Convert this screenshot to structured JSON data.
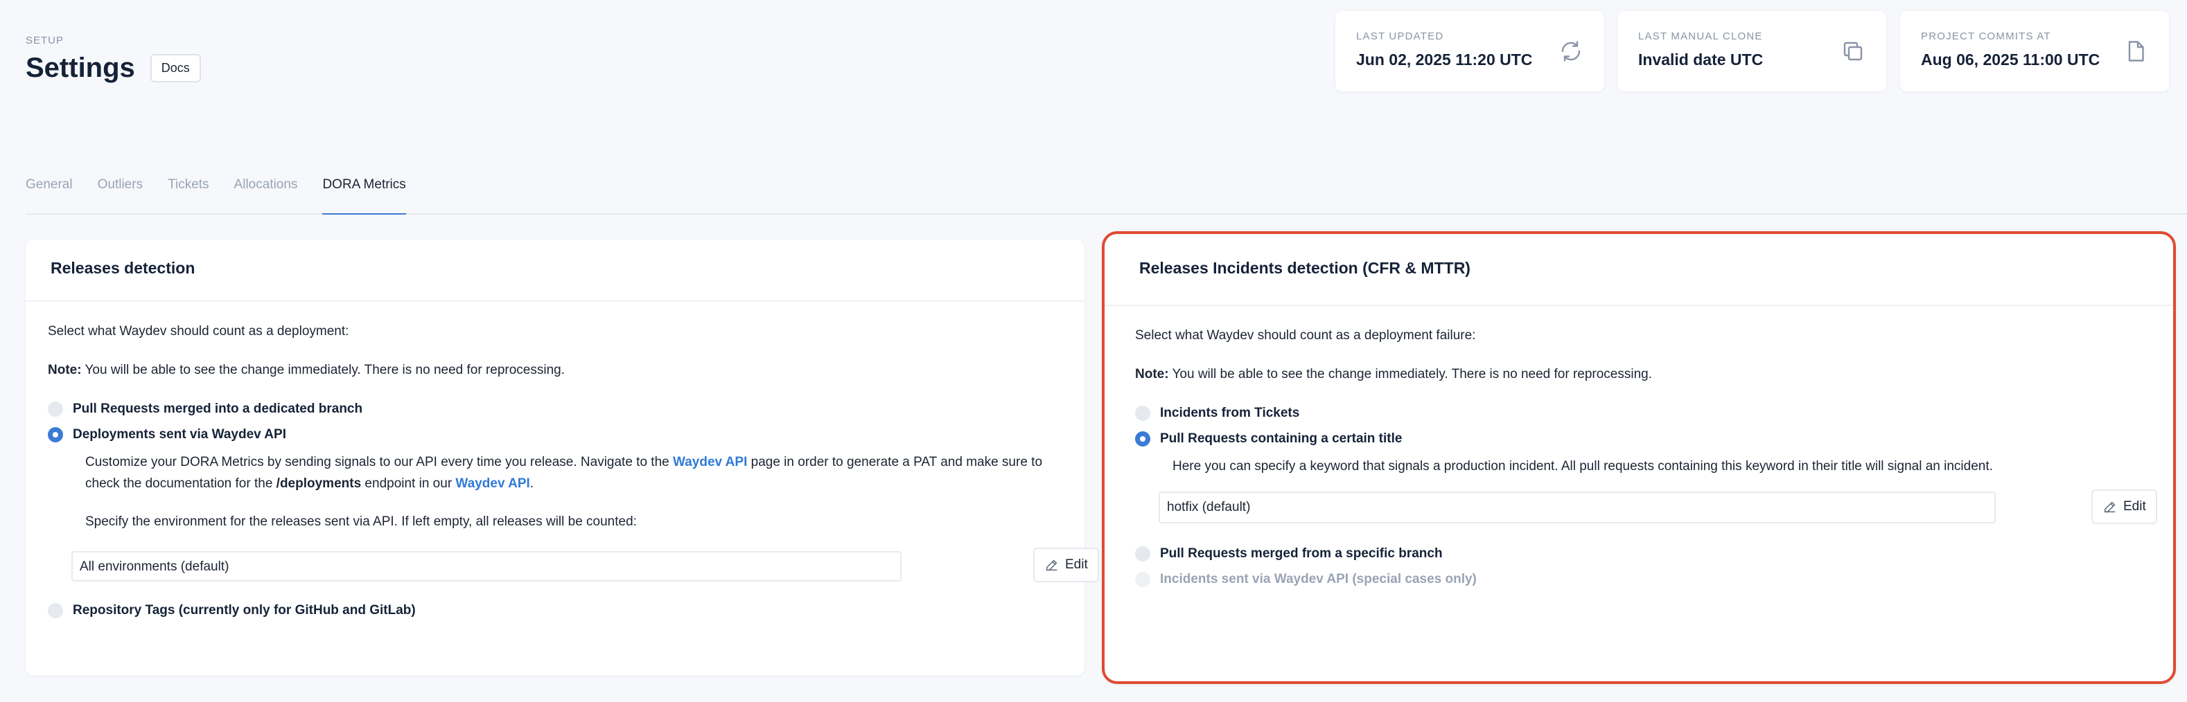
{
  "header": {
    "setup_label": "SETUP",
    "title": "Settings",
    "docs_label": "Docs"
  },
  "stats": [
    {
      "label": "LAST UPDATED",
      "value": "Jun 02, 2025 11:20 UTC",
      "icon": "refresh-icon"
    },
    {
      "label": "LAST MANUAL CLONE",
      "value": "Invalid date UTC",
      "icon": "copy-icon"
    },
    {
      "label": "PROJECT COMMITS AT",
      "value": "Aug 06, 2025 11:00 UTC",
      "icon": "file-icon"
    }
  ],
  "tabs": [
    {
      "label": "General"
    },
    {
      "label": "Outliers"
    },
    {
      "label": "Tickets"
    },
    {
      "label": "Allocations"
    },
    {
      "label": "DORA Metrics",
      "active": true
    }
  ],
  "releases": {
    "title": "Releases detection",
    "prompt": "Select what Waydev should count as a deployment:",
    "note_label": "Note:",
    "note_text": " You will be able to see the change immediately. There is no need for reprocessing.",
    "option_pr": "Pull Requests merged into a dedicated branch",
    "option_api": "Deployments sent via Waydev API",
    "desc_1": "Customize your DORA Metrics by sending signals to our API every time you release. Navigate to the ",
    "desc_link_1": "Waydev API",
    "desc_2": " page in order to generate a PAT and make sure to check the documentation for the ",
    "desc_endpoint": "/deployments",
    "desc_3": " endpoint in our ",
    "desc_link_2": "Waydev API",
    "desc_4": ".",
    "env_prompt": "Specify the environment for the releases sent via API. If left empty, all releases will be counted:",
    "env_value": "All environments (default)",
    "edit_label": "Edit",
    "option_tags": "Repository Tags (currently only for GitHub and GitLab)"
  },
  "incidents": {
    "title": "Releases Incidents detection (CFR & MTTR)",
    "prompt": "Select what Waydev should count as a deployment failure:",
    "note_label": "Note:",
    "note_text": " You will be able to see the change immediately. There is no need for reprocessing.",
    "option_tickets": "Incidents from Tickets",
    "option_title": "Pull Requests containing a certain title",
    "desc": "Here you can specify a keyword that signals a production incident. All pull requests containing this keyword in their title will signal an incident.",
    "keyword_value": "hotfix (default)",
    "edit_label": "Edit",
    "option_branch": "Pull Requests merged from a specific branch",
    "option_api": "Incidents sent via Waydev API (special cases only)"
  },
  "colors": {
    "accent": "#3a7bd5",
    "highlight_border": "#e04a33",
    "link": "#2f7ad6"
  }
}
